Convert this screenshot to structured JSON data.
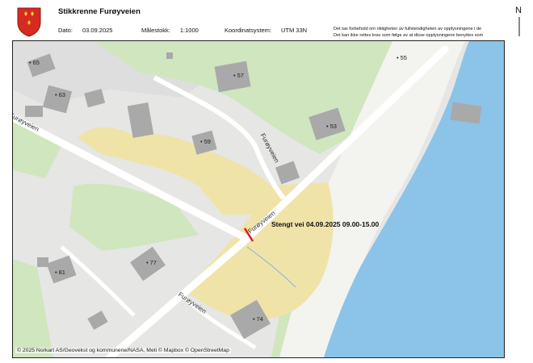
{
  "header": {
    "title": "Stikkrenne Furøyveien",
    "date_label": "Dato:",
    "date_value": "03.09.2025",
    "scale_label": "Målestokk:",
    "scale_value": "1:1000",
    "crs_label": "Koordinatsystem:",
    "crs_value": "UTM 33N",
    "disclaimer_line1": "Det tas forbehold om riktigheten av fullstendigheten av opplysningene i de",
    "disclaimer_line2": "Det kan ikke rettes krav som følge av at disse opplysningene benyttes som",
    "north_letter": "N"
  },
  "map": {
    "closure_label": "Stengt vei 04.09.2025 09.00-15.00",
    "closure_color": "#e8141b",
    "road_labels": [
      "Furøyveien",
      "Furøyveien",
      "Furøyveien",
      "Furøyveien"
    ],
    "address_labels": [
      "65",
      "63",
      "57",
      "55",
      "53",
      "59",
      "81",
      "77",
      "74"
    ],
    "attribution": "© 2025 Norkart AS/Geovekst og kommunene/NASA, Meti © Mapbox © OpenStreetMap",
    "colors": {
      "water": "#8cc3e8",
      "forest": "#cfe6bf",
      "closure_area": "#efe3a8",
      "built": "#dcdcdc",
      "building": "#a9a9a9",
      "road": "#ffffff"
    }
  }
}
